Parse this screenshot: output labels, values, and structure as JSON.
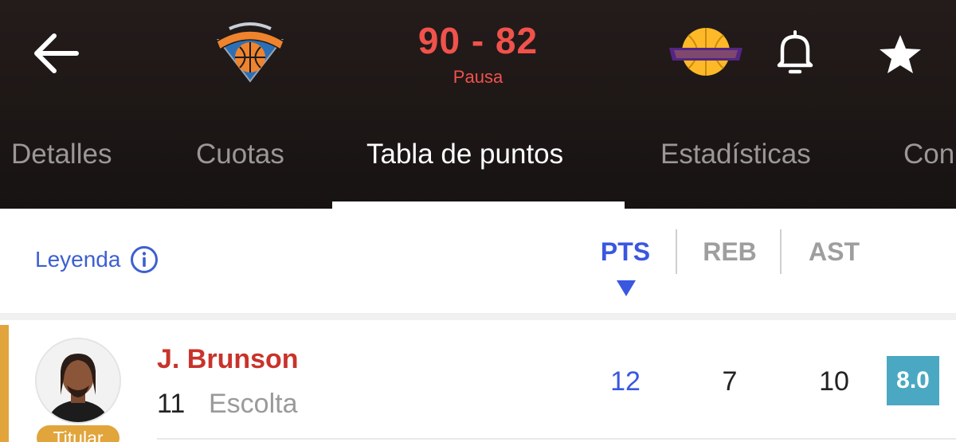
{
  "header": {
    "home_team_logo": "knicks-logo",
    "away_team_logo": "lakers-logo",
    "score": "90 - 82",
    "status": "Pausa",
    "colors": {
      "background": "#1d1716",
      "score": "#f0524c"
    },
    "icons": [
      "back-arrow-icon",
      "bell-icon",
      "star-icon"
    ]
  },
  "tabs": [
    {
      "label": "Detalles"
    },
    {
      "label": "Cuotas"
    },
    {
      "label": "Tabla de puntos",
      "active": true
    },
    {
      "label": "Estadísticas"
    },
    {
      "label": "Con"
    }
  ],
  "legend": {
    "label": "Leyenda",
    "icon": "info-icon"
  },
  "columns": [
    {
      "label": "PTS",
      "active": true,
      "sorted": "desc"
    },
    {
      "label": "REB"
    },
    {
      "label": "AST"
    }
  ],
  "players": [
    {
      "name": "J. Brunson",
      "number": "11",
      "position": "Escolta",
      "badge": "Titular",
      "pts": "12",
      "reb": "7",
      "ast": "10",
      "rating": "8.0",
      "accent_color": "#e1a53c",
      "rating_color": "#4aa8c2"
    }
  ]
}
